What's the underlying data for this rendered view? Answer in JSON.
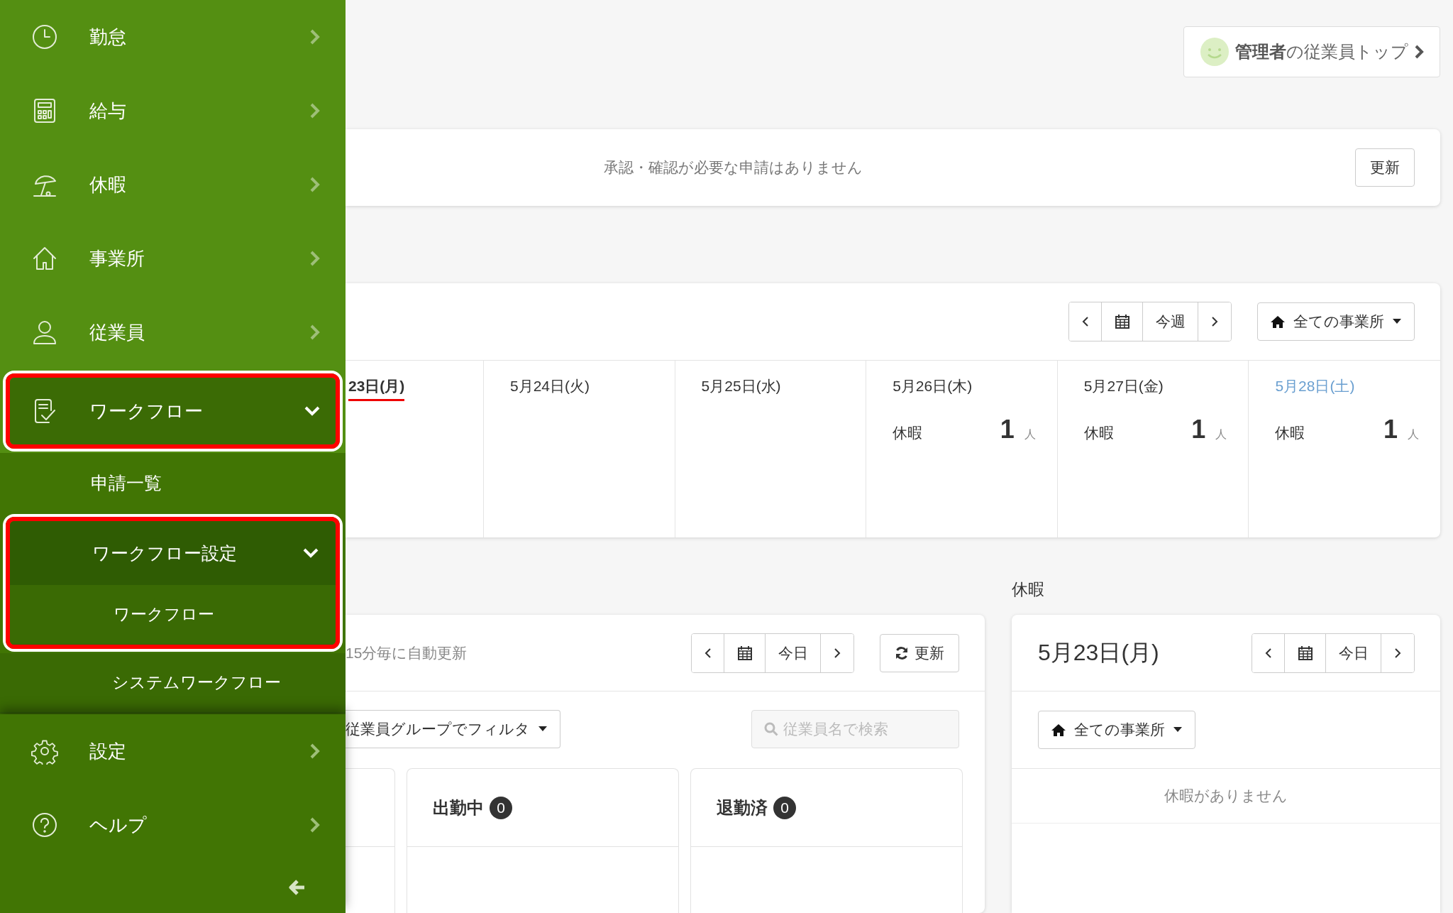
{
  "sidebar": {
    "items": [
      {
        "label": "勤怠",
        "expanded": false,
        "highlighted": false
      },
      {
        "label": "給与",
        "expanded": false,
        "highlighted": false
      },
      {
        "label": "休暇",
        "expanded": false,
        "highlighted": false
      },
      {
        "label": "事業所",
        "expanded": false,
        "highlighted": false
      },
      {
        "label": "従業員",
        "expanded": false,
        "highlighted": false
      },
      {
        "label": "ワークフロー",
        "expanded": true,
        "highlighted": true,
        "children": [
          {
            "label": "申請一覧",
            "highlighted": false
          },
          {
            "label": "ワークフロー設定",
            "expanded": true,
            "highlighted": true,
            "children": [
              {
                "label": "ワークフロー",
                "highlighted": true
              },
              {
                "label": "システムワークフロー",
                "highlighted": false
              }
            ]
          }
        ]
      }
    ],
    "bottom_items": [
      {
        "label": "設定",
        "expanded": false
      },
      {
        "label": "ヘルプ",
        "expanded": false
      }
    ]
  },
  "admin_button": {
    "label": "**管理者**の従業員トップ"
  },
  "notice": {
    "message": "承認・確認が必要な申請はありません",
    "button": "更新"
  },
  "week": {
    "period_button": "今週",
    "site_filter": "全ての事業所",
    "days": [
      {
        "label": "23日(月)",
        "today": true,
        "color": "#333333"
      },
      {
        "label": "5月24日(火)",
        "today": false,
        "color": "#333333"
      },
      {
        "label": "5月25日(水)",
        "today": false,
        "color": "#333333"
      },
      {
        "label": "5月26日(木)",
        "today": false,
        "color": "#333333",
        "entries": [
          {
            "label": "休暇",
            "count": "1",
            "unit": "人"
          }
        ]
      },
      {
        "label": "5月27日(金)",
        "today": false,
        "color": "#333333",
        "entries": [
          {
            "label": "休暇",
            "count": "1",
            "unit": "人"
          }
        ]
      },
      {
        "label": "5月28日(土)",
        "today": false,
        "color": "#6a9fd0",
        "entries": [
          {
            "label": "休暇",
            "count": "1",
            "unit": "人"
          }
        ]
      }
    ]
  },
  "attendance": {
    "auto_refresh": "15分毎に自動更新",
    "today_button": "今日",
    "refresh_button": "更新",
    "group_filter": "従業員グループでフィルタ",
    "search": {
      "placeholder": "従業員名で検索"
    },
    "boards": [
      {
        "label": "出勤中",
        "count": "0"
      },
      {
        "label": "退勤済",
        "count": "0"
      }
    ]
  },
  "leave": {
    "heading": "休暇",
    "date": "5月23日(月)",
    "today_button": "今日",
    "site_filter": "全ての事業所",
    "empty_message": "休暇がありません"
  }
}
